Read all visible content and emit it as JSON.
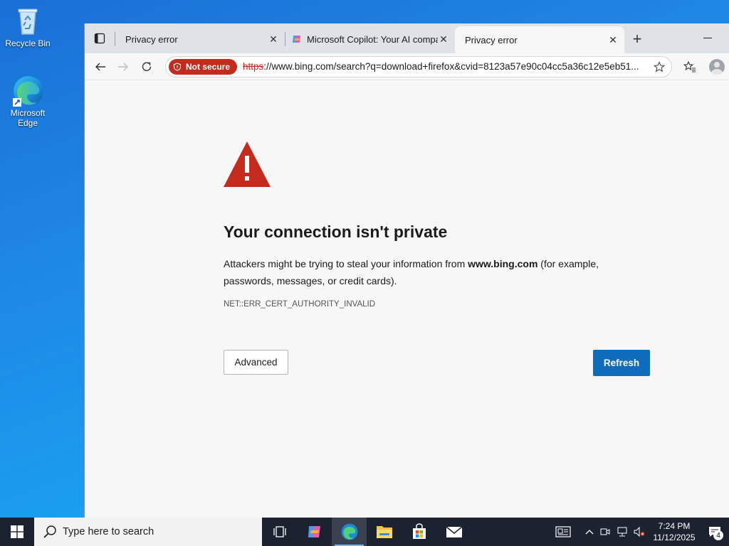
{
  "desktop": {
    "icons": [
      {
        "label": "Recycle Bin",
        "icon": "recycle-bin-icon"
      },
      {
        "label": "Microsoft Edge",
        "icon": "edge-icon"
      }
    ]
  },
  "browser": {
    "tabs": [
      {
        "title": "Privacy error",
        "active": false
      },
      {
        "title": "Microsoft Copilot: Your AI compa",
        "active": false,
        "icon": "copilot-icon"
      },
      {
        "title": "Privacy error",
        "active": true
      }
    ],
    "address": {
      "security_badge": "Not secure",
      "url_scheme": "https",
      "url_rest": "://www.bing.com/search?q=download+firefox&cvid=8123a57e90c04cc5a36c12e5eb51..."
    }
  },
  "error_page": {
    "heading": "Your connection isn't private",
    "desc_before": "Attackers might be trying to steal your information from ",
    "desc_domain": "www.bing.com",
    "desc_after": " (for example, passwords, messages, or credit cards).",
    "error_code": "NET::ERR_CERT_AUTHORITY_INVALID",
    "advanced_label": "Advanced",
    "refresh_label": "Refresh"
  },
  "taskbar": {
    "search_placeholder": "Type here to search",
    "time": "7:24 PM",
    "date": "11/12/2025",
    "notification_count": "4"
  },
  "colors": {
    "danger": "#c42b1c",
    "accent": "#0f6cbd",
    "taskbar": "#1b2230"
  }
}
